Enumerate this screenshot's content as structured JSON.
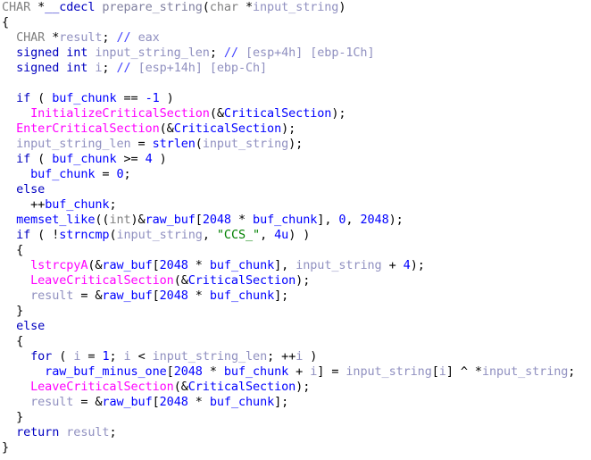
{
  "view": {
    "name": "hex-rays-pseudocode",
    "background": "#ffffff",
    "font_size_px": 13.5,
    "line_height_px": 17
  },
  "colors": {
    "plain": "#000000",
    "keyword": "#0000c0",
    "type": "#808080",
    "function_name": "#8080a0",
    "api_call": "#ff00ff",
    "library_call": "#0000ff",
    "local_var": "#9090c0",
    "number": "#0000ff",
    "string_literal": "#008000",
    "comment": "#9090c0",
    "comment_marker": "#4040ff"
  },
  "code": {
    "language": "c-pseudocode",
    "function_signature": "CHAR *__cdecl prepare_string(char *input_string)",
    "function_name": "prepare_string",
    "return_type": "CHAR *",
    "calling_convention": "__cdecl",
    "parameters": [
      "char *input_string"
    ],
    "locals": [
      {
        "declaration": "CHAR *result;",
        "comment": "// eax"
      },
      {
        "declaration": "signed int input_string_len;",
        "comment": "// [esp+4h] [ebp-1Ch]"
      },
      {
        "declaration": "signed int i;",
        "comment": "// [esp+14h] [ebp-Ch]"
      }
    ],
    "identifiers": {
      "api_calls": [
        "InitializeCriticalSection",
        "EnterCriticalSection",
        "LeaveCriticalSection",
        "lstrcpyA"
      ],
      "library_calls": [
        "strlen",
        "strncmp",
        "memset_like"
      ],
      "globals": [
        "CriticalSection",
        "buf_chunk",
        "raw_buf",
        "raw_buf_minus_one"
      ],
      "locals": [
        "result",
        "input_string",
        "input_string_len",
        "i"
      ]
    },
    "literals": {
      "strings": [
        "\"CCS_\""
      ],
      "numbers": [
        "-1",
        "4",
        "0",
        "2048",
        "4u",
        "1"
      ]
    },
    "lines": [
      {
        "n": 1,
        "indent": 0,
        "text": "CHAR *__cdecl prepare_string(char *input_string)"
      },
      {
        "n": 2,
        "indent": 0,
        "text": "{"
      },
      {
        "n": 3,
        "indent": 1,
        "text": "CHAR *result; // eax"
      },
      {
        "n": 4,
        "indent": 1,
        "text": "signed int input_string_len; // [esp+4h] [ebp-1Ch]"
      },
      {
        "n": 5,
        "indent": 1,
        "text": "signed int i; // [esp+14h] [ebp-Ch]"
      },
      {
        "n": 6,
        "indent": 0,
        "text": ""
      },
      {
        "n": 7,
        "indent": 1,
        "text": "if ( buf_chunk == -1 )"
      },
      {
        "n": 8,
        "indent": 2,
        "text": "InitializeCriticalSection(&CriticalSection);"
      },
      {
        "n": 9,
        "indent": 1,
        "text": "EnterCriticalSection(&CriticalSection);"
      },
      {
        "n": 10,
        "indent": 1,
        "text": "input_string_len = strlen(input_string);"
      },
      {
        "n": 11,
        "indent": 1,
        "text": "if ( buf_chunk >= 4 )"
      },
      {
        "n": 12,
        "indent": 2,
        "text": "buf_chunk = 0;"
      },
      {
        "n": 13,
        "indent": 1,
        "text": "else"
      },
      {
        "n": 14,
        "indent": 2,
        "text": "++buf_chunk;"
      },
      {
        "n": 15,
        "indent": 1,
        "text": "memset_like((int)&raw_buf[2048 * buf_chunk], 0, 2048);"
      },
      {
        "n": 16,
        "indent": 1,
        "text": "if ( !strncmp(input_string, \"CCS_\", 4u) )"
      },
      {
        "n": 17,
        "indent": 1,
        "text": "{"
      },
      {
        "n": 18,
        "indent": 2,
        "text": "lstrcpyA(&raw_buf[2048 * buf_chunk], input_string + 4);"
      },
      {
        "n": 19,
        "indent": 2,
        "text": "LeaveCriticalSection(&CriticalSection);"
      },
      {
        "n": 20,
        "indent": 2,
        "text": "result = &raw_buf[2048 * buf_chunk];"
      },
      {
        "n": 21,
        "indent": 1,
        "text": "}"
      },
      {
        "n": 22,
        "indent": 1,
        "text": "else"
      },
      {
        "n": 23,
        "indent": 1,
        "text": "{"
      },
      {
        "n": 24,
        "indent": 2,
        "text": "for ( i = 1; i < input_string_len; ++i )"
      },
      {
        "n": 25,
        "indent": 3,
        "text": "raw_buf_minus_one[2048 * buf_chunk + i] = input_string[i] ^ *input_string;"
      },
      {
        "n": 26,
        "indent": 2,
        "text": "LeaveCriticalSection(&CriticalSection);"
      },
      {
        "n": 27,
        "indent": 2,
        "text": "result = &raw_buf[2048 * buf_chunk];"
      },
      {
        "n": 28,
        "indent": 1,
        "text": "}"
      },
      {
        "n": 29,
        "indent": 1,
        "text": "return result;"
      },
      {
        "n": 30,
        "indent": 0,
        "text": "}"
      }
    ],
    "tokens": [
      [
        [
          "CHAR ",
          "type"
        ],
        [
          "*",
          "plain"
        ],
        [
          "__cdecl ",
          "keyword"
        ],
        [
          "prepare_string",
          "func"
        ],
        [
          "(",
          "plain"
        ],
        [
          "char ",
          "type"
        ],
        [
          "*",
          "plain"
        ],
        [
          "input_string",
          "local"
        ],
        [
          ")",
          "plain"
        ]
      ],
      [
        [
          "{",
          "plain"
        ]
      ],
      [
        [
          "  ",
          "plain"
        ],
        [
          "CHAR ",
          "type"
        ],
        [
          "*",
          "plain"
        ],
        [
          "result",
          "local"
        ],
        [
          "; ",
          "plain"
        ],
        [
          "// ",
          "cmtmark"
        ],
        [
          "eax",
          "comment"
        ]
      ],
      [
        [
          "  ",
          "plain"
        ],
        [
          "signed int ",
          "keyword"
        ],
        [
          "input_string_len",
          "local"
        ],
        [
          "; ",
          "plain"
        ],
        [
          "// ",
          "cmtmark"
        ],
        [
          "[esp+4h] [ebp-1Ch]",
          "comment"
        ]
      ],
      [
        [
          "  ",
          "plain"
        ],
        [
          "signed int ",
          "keyword"
        ],
        [
          "i",
          "local"
        ],
        [
          "; ",
          "plain"
        ],
        [
          "// ",
          "cmtmark"
        ],
        [
          "[esp+14h] [ebp-Ch]",
          "comment"
        ]
      ],
      [
        [
          "",
          "plain"
        ]
      ],
      [
        [
          "  ",
          "plain"
        ],
        [
          "if",
          "keyword"
        ],
        [
          " ( ",
          "plain"
        ],
        [
          "buf_chunk",
          "lib"
        ],
        [
          " == ",
          "plain"
        ],
        [
          "-1",
          "num"
        ],
        [
          " )",
          "plain"
        ]
      ],
      [
        [
          "    ",
          "plain"
        ],
        [
          "InitializeCriticalSection",
          "api"
        ],
        [
          "(&",
          "plain"
        ],
        [
          "CriticalSection",
          "lib"
        ],
        [
          ");",
          "plain"
        ]
      ],
      [
        [
          "  ",
          "plain"
        ],
        [
          "EnterCriticalSection",
          "api"
        ],
        [
          "(&",
          "plain"
        ],
        [
          "CriticalSection",
          "lib"
        ],
        [
          ");",
          "plain"
        ]
      ],
      [
        [
          "  ",
          "plain"
        ],
        [
          "input_string_len",
          "local"
        ],
        [
          " = ",
          "plain"
        ],
        [
          "strlen",
          "lib"
        ],
        [
          "(",
          "plain"
        ],
        [
          "input_string",
          "local"
        ],
        [
          ");",
          "plain"
        ]
      ],
      [
        [
          "  ",
          "plain"
        ],
        [
          "if",
          "keyword"
        ],
        [
          " ( ",
          "plain"
        ],
        [
          "buf_chunk",
          "lib"
        ],
        [
          " >= ",
          "plain"
        ],
        [
          "4",
          "num"
        ],
        [
          " )",
          "plain"
        ]
      ],
      [
        [
          "    ",
          "plain"
        ],
        [
          "buf_chunk",
          "lib"
        ],
        [
          " = ",
          "plain"
        ],
        [
          "0",
          "num"
        ],
        [
          ";",
          "plain"
        ]
      ],
      [
        [
          "  ",
          "plain"
        ],
        [
          "else",
          "keyword"
        ]
      ],
      [
        [
          "    ",
          "plain"
        ],
        [
          "++",
          "plain"
        ],
        [
          "buf_chunk",
          "lib"
        ],
        [
          ";",
          "plain"
        ]
      ],
      [
        [
          "  ",
          "plain"
        ],
        [
          "memset_like",
          "lib"
        ],
        [
          "((",
          "plain"
        ],
        [
          "int",
          "type"
        ],
        [
          ")&",
          "plain"
        ],
        [
          "raw_buf",
          "lib"
        ],
        [
          "[",
          "plain"
        ],
        [
          "2048",
          "num"
        ],
        [
          " * ",
          "plain"
        ],
        [
          "buf_chunk",
          "lib"
        ],
        [
          "], ",
          "plain"
        ],
        [
          "0",
          "num"
        ],
        [
          ", ",
          "plain"
        ],
        [
          "2048",
          "num"
        ],
        [
          ");",
          "plain"
        ]
      ],
      [
        [
          "  ",
          "plain"
        ],
        [
          "if",
          "keyword"
        ],
        [
          " ( !",
          "plain"
        ],
        [
          "strncmp",
          "lib"
        ],
        [
          "(",
          "plain"
        ],
        [
          "input_string",
          "local"
        ],
        [
          ", ",
          "plain"
        ],
        [
          "\"CCS_\"",
          "str"
        ],
        [
          ", ",
          "plain"
        ],
        [
          "4u",
          "num"
        ],
        [
          ") )",
          "plain"
        ]
      ],
      [
        [
          "  ",
          "plain"
        ],
        [
          "{",
          "plain"
        ]
      ],
      [
        [
          "    ",
          "plain"
        ],
        [
          "lstrcpyA",
          "api"
        ],
        [
          "(&",
          "plain"
        ],
        [
          "raw_buf",
          "lib"
        ],
        [
          "[",
          "plain"
        ],
        [
          "2048",
          "num"
        ],
        [
          " * ",
          "plain"
        ],
        [
          "buf_chunk",
          "lib"
        ],
        [
          "], ",
          "plain"
        ],
        [
          "input_string",
          "local"
        ],
        [
          " + ",
          "plain"
        ],
        [
          "4",
          "num"
        ],
        [
          ");",
          "plain"
        ]
      ],
      [
        [
          "    ",
          "plain"
        ],
        [
          "LeaveCriticalSection",
          "api"
        ],
        [
          "(&",
          "plain"
        ],
        [
          "CriticalSection",
          "lib"
        ],
        [
          ");",
          "plain"
        ]
      ],
      [
        [
          "    ",
          "plain"
        ],
        [
          "result",
          "local"
        ],
        [
          " = &",
          "plain"
        ],
        [
          "raw_buf",
          "lib"
        ],
        [
          "[",
          "plain"
        ],
        [
          "2048",
          "num"
        ],
        [
          " * ",
          "plain"
        ],
        [
          "buf_chunk",
          "lib"
        ],
        [
          "];",
          "plain"
        ]
      ],
      [
        [
          "  ",
          "plain"
        ],
        [
          "}",
          "plain"
        ]
      ],
      [
        [
          "  ",
          "plain"
        ],
        [
          "else",
          "keyword"
        ]
      ],
      [
        [
          "  ",
          "plain"
        ],
        [
          "{",
          "plain"
        ]
      ],
      [
        [
          "    ",
          "plain"
        ],
        [
          "for",
          "keyword"
        ],
        [
          " ( ",
          "plain"
        ],
        [
          "i",
          "local"
        ],
        [
          " = ",
          "plain"
        ],
        [
          "1",
          "num"
        ],
        [
          "; ",
          "plain"
        ],
        [
          "i",
          "local"
        ],
        [
          " < ",
          "plain"
        ],
        [
          "input_string_len",
          "local"
        ],
        [
          "; ++",
          "plain"
        ],
        [
          "i",
          "local"
        ],
        [
          " )",
          "plain"
        ]
      ],
      [
        [
          "      ",
          "plain"
        ],
        [
          "raw_buf_minus_one",
          "lib"
        ],
        [
          "[",
          "plain"
        ],
        [
          "2048",
          "num"
        ],
        [
          " * ",
          "plain"
        ],
        [
          "buf_chunk",
          "lib"
        ],
        [
          " + ",
          "plain"
        ],
        [
          "i",
          "local"
        ],
        [
          "] = ",
          "plain"
        ],
        [
          "input_string",
          "local"
        ],
        [
          "[",
          "plain"
        ],
        [
          "i",
          "local"
        ],
        [
          "] ^ *",
          "plain"
        ],
        [
          "input_string",
          "local"
        ],
        [
          ";",
          "plain"
        ]
      ],
      [
        [
          "    ",
          "plain"
        ],
        [
          "LeaveCriticalSection",
          "api"
        ],
        [
          "(&",
          "plain"
        ],
        [
          "CriticalSection",
          "lib"
        ],
        [
          ");",
          "plain"
        ]
      ],
      [
        [
          "    ",
          "plain"
        ],
        [
          "result",
          "local"
        ],
        [
          " = &",
          "plain"
        ],
        [
          "raw_buf",
          "lib"
        ],
        [
          "[",
          "plain"
        ],
        [
          "2048",
          "num"
        ],
        [
          " * ",
          "plain"
        ],
        [
          "buf_chunk",
          "lib"
        ],
        [
          "];",
          "plain"
        ]
      ],
      [
        [
          "  ",
          "plain"
        ],
        [
          "}",
          "plain"
        ]
      ],
      [
        [
          "  ",
          "plain"
        ],
        [
          "return",
          "keyword"
        ],
        [
          " ",
          "plain"
        ],
        [
          "result",
          "local"
        ],
        [
          ";",
          "plain"
        ]
      ],
      [
        [
          "}",
          "plain"
        ]
      ]
    ]
  }
}
